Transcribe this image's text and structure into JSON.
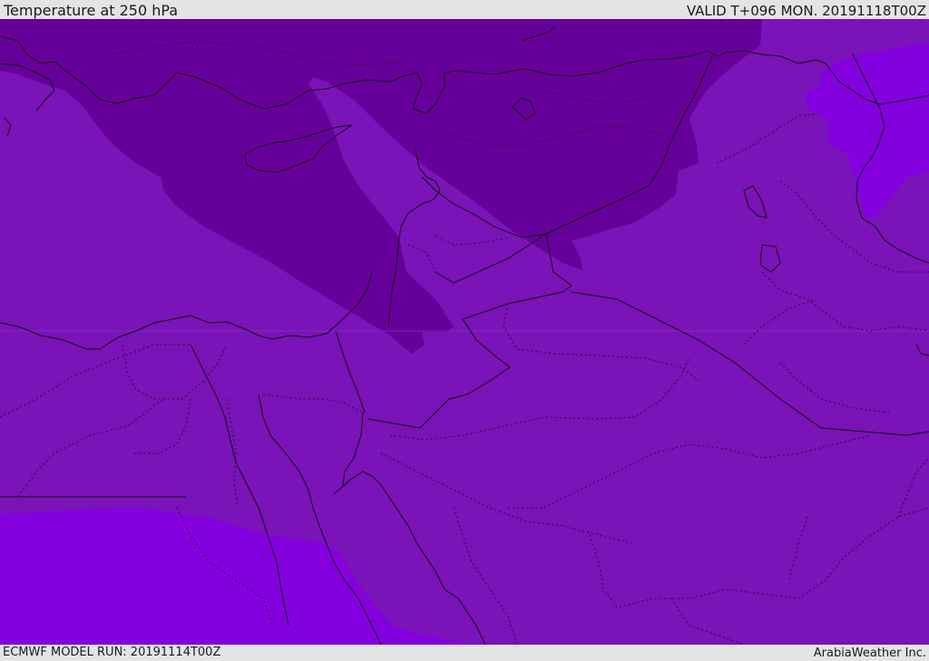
{
  "header": {
    "title": "Temperature at 250 hPa",
    "valid": "VALID T+096 MON. 20191118T00Z"
  },
  "footer": {
    "model_run": "ECMWF MODEL RUN: 20191114T00Z",
    "credit": "ArabiaWeather Inc."
  },
  "map": {
    "field": "temperature",
    "level": "250 hPa",
    "colors": {
      "base": "#7a13b8",
      "cold": "#66009a",
      "warm": "#8400de",
      "coast": "#101010",
      "border": "#101010",
      "internal": "#2a0c3a"
    }
  }
}
